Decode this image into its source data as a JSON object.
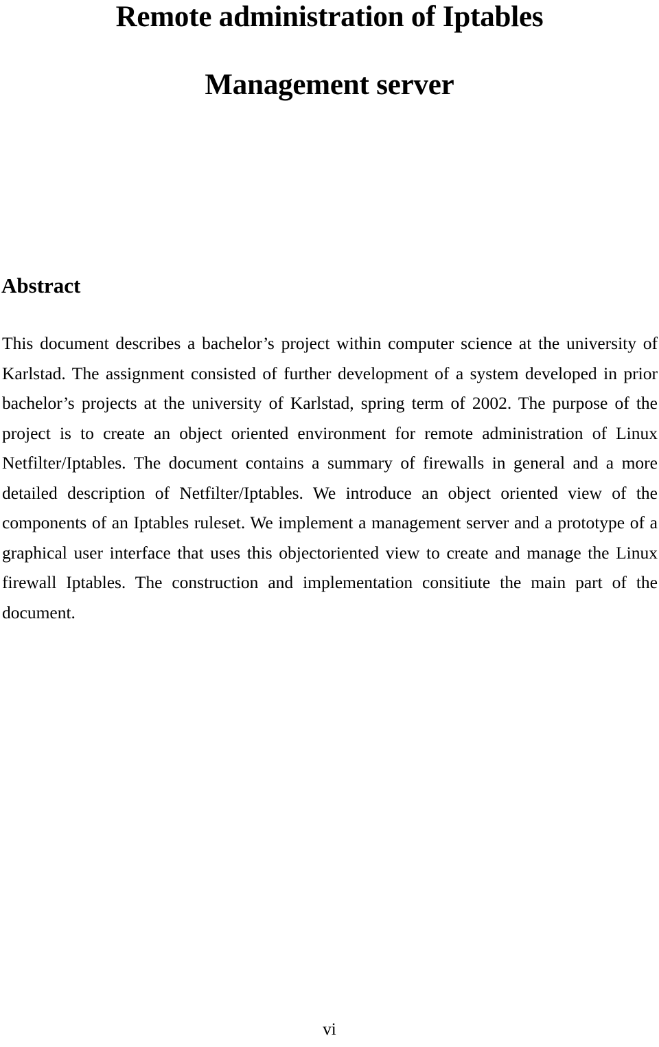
{
  "document": {
    "title": "Remote administration of Iptables",
    "subtitle": "Management server",
    "abstract_heading": "Abstract",
    "abstract_body": "This document describes a bachelor’s project within computer science at the university of Karlstad. The assignment consisted of further development of a system developed in prior bachelor’s projects at the university of Karlstad, spring term of 2002. The purpose of the project is to create an object oriented environment for remote administration of Linux Netfilter/Iptables. The document contains a summary of firewalls in general and a more detailed description of Netfilter/Iptables. We introduce an object oriented view of the components of an Iptables ruleset. We implement a management server and a prototype of a graphical user interface that uses this objectoriented view to create and manage the Linux firewall Iptables. The construction and implementation consitiute the main part of the document.",
    "page_number": "vi"
  },
  "colors": {
    "page_background": "#ffffff",
    "text": "#000000"
  }
}
